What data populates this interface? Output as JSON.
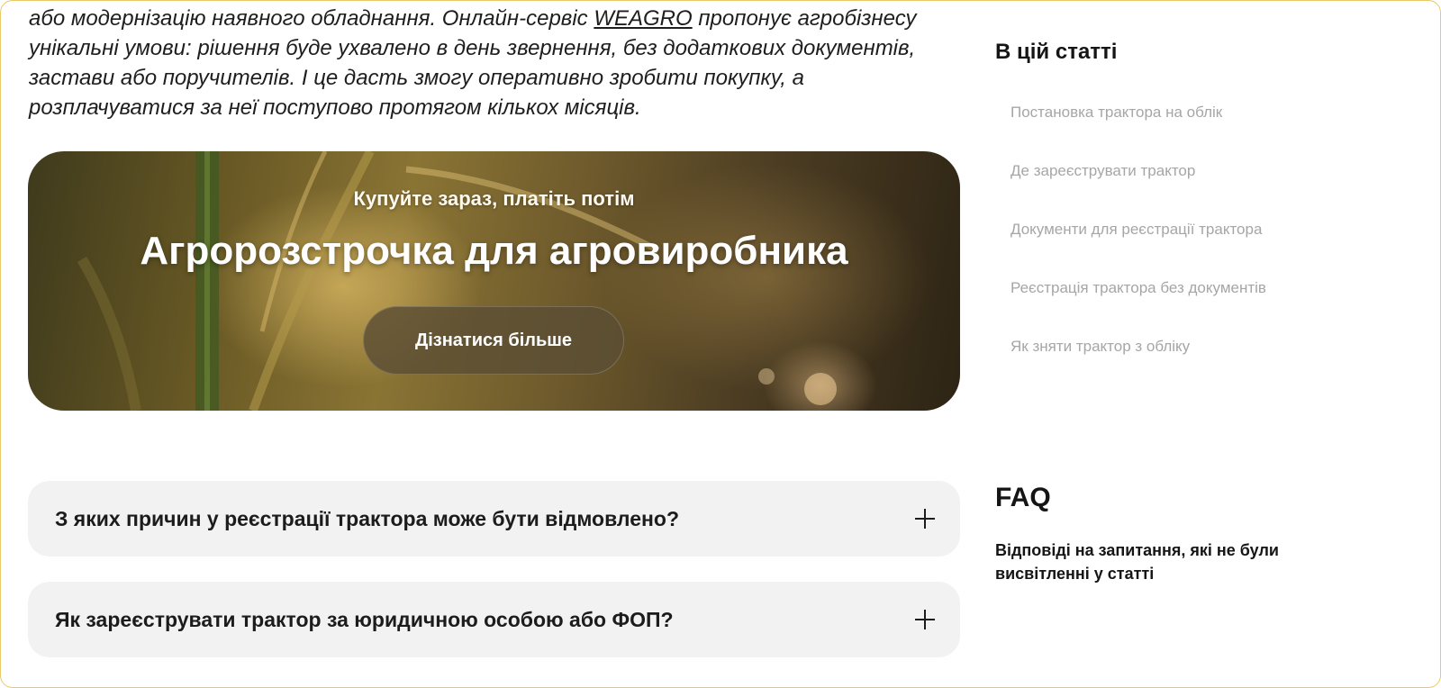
{
  "article": {
    "intro_lead": "або модернізацію наявного обладнання. Онлайн-сервіс ",
    "intro_link": "WEAGRO",
    "intro_tail": " пропонує агробізнесу унікальні умови: рішення буде ухвалено в день звернення, без додаткових документів, застави або поручителів. І це дасть змогу оперативно зробити покупку, а розплачуватися за неї поступово протягом кількох місяців."
  },
  "banner": {
    "eyebrow": "Купуйте зараз, платіть потім",
    "title": "Агророзстрочка для агровиробника",
    "button_label": "Дізнатися більше"
  },
  "faq_items": [
    {
      "question": "З яких причин у реєстрації трактора може бути відмовлено?",
      "icon": "plus-icon"
    },
    {
      "question": "Як зареєструвати трактор за юридичною особою або ФОП?",
      "icon": "plus-icon"
    }
  ],
  "sidebar": {
    "toc_title": "В цій статті",
    "toc_items": [
      "Постановка трактора на облік",
      "Де зареєструвати трактор",
      "Документи для реєстрації трактора",
      "Реєстрація трактора без документів",
      "Як зняти трактор з обліку"
    ],
    "faq_heading": "FAQ",
    "faq_subtitle": "Відповіді на запитання, які не були висвітленні у статті"
  },
  "colors": {
    "frame_border": "#e8c96a",
    "faq_background": "#f3f2f3",
    "toc_link": "#a6a6a6"
  }
}
